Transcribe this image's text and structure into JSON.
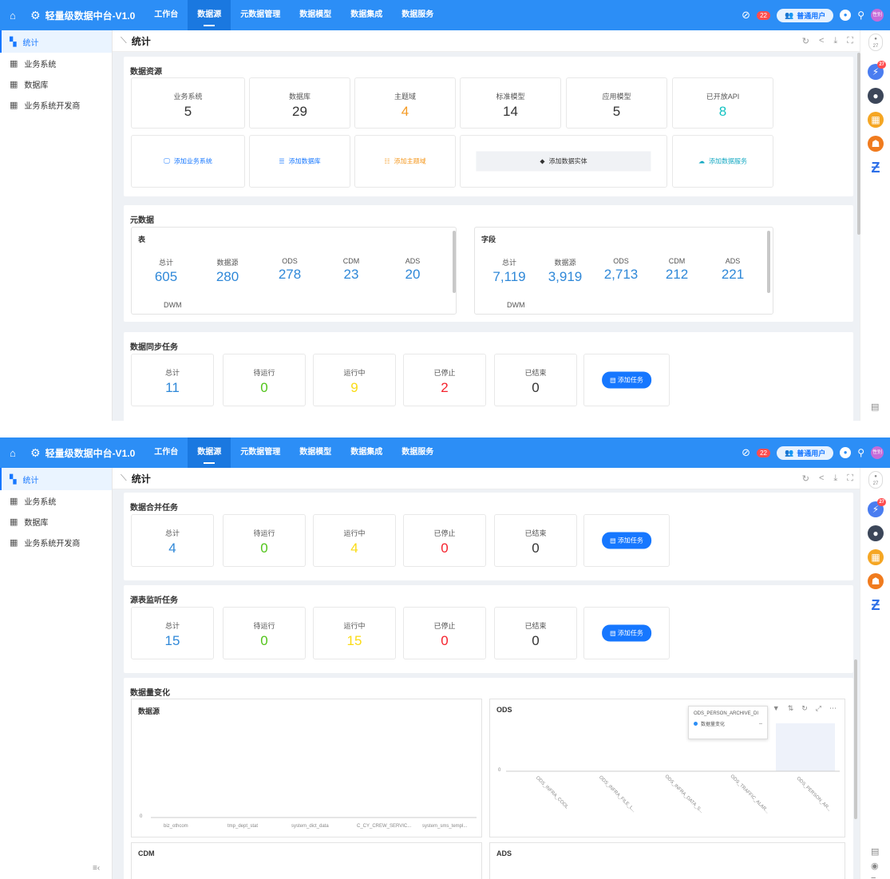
{
  "topbar": {
    "brand": "轻量级数据中台-V1.0",
    "tabs": [
      "工作台",
      "数据源",
      "元数据管理",
      "数据模型",
      "数据集成",
      "数据服务"
    ],
    "active_tab": 1,
    "badge_count": "22",
    "user_label": "普通用户",
    "avatar_text": "性别"
  },
  "sidebar": {
    "items": [
      {
        "label": "统计",
        "icon": "dashboard-icon"
      },
      {
        "label": "业务系统",
        "icon": "table-icon"
      },
      {
        "label": "数据库",
        "icon": "table-icon"
      },
      {
        "label": "业务系统开发商",
        "icon": "table-icon"
      }
    ],
    "collapse_icon": "≡‹"
  },
  "breadcrumb": {
    "title": "统计"
  },
  "rightrail": {
    "top_label": "27",
    "badge": "27"
  },
  "resources": {
    "title": "数据资源",
    "stats": [
      {
        "label": "业务系统",
        "value": "5"
      },
      {
        "label": "数据库",
        "value": "29"
      },
      {
        "label": "主题域",
        "value": "4"
      },
      {
        "label": "标准模型",
        "value": "14"
      },
      {
        "label": "应用模型",
        "value": "5"
      },
      {
        "label": "已开放API",
        "value": "8"
      }
    ],
    "actions": [
      "添加业务系统",
      "添加数据库",
      "添加主题域",
      "添加数据实体",
      "添加数据服务"
    ]
  },
  "metadata": {
    "title": "元数据",
    "tables": {
      "title": "表",
      "labels": [
        "总计",
        "数据源",
        "ODS",
        "CDM",
        "ADS"
      ],
      "values": [
        "605",
        "280",
        "278",
        "23",
        "20"
      ],
      "extra": "DWM"
    },
    "fields": {
      "title": "字段",
      "labels": [
        "总计",
        "数据源",
        "ODS",
        "CDM",
        "ADS"
      ],
      "values": [
        "7,119",
        "3,919",
        "2,713",
        "212",
        "221"
      ],
      "extra": "DWM"
    }
  },
  "task_labels": [
    "总计",
    "待运行",
    "运行中",
    "已停止",
    "已结束"
  ],
  "add_task": "添加任务",
  "sync_tasks": {
    "title": "数据同步任务",
    "values": [
      "11",
      "0",
      "9",
      "2",
      "0"
    ]
  },
  "merge_tasks": {
    "title": "数据合并任务",
    "values": [
      "4",
      "0",
      "4",
      "0",
      "0"
    ]
  },
  "monitor_tasks": {
    "title": "源表监听任务",
    "values": [
      "15",
      "0",
      "15",
      "0",
      "0"
    ]
  },
  "volume": {
    "title": "数据量变化",
    "charts": [
      {
        "title": "数据源",
        "y0": "0",
        "x": [
          "biz_othcom",
          "tmp_dept_stat",
          "system_dict_data",
          "C_CY_CREW_SERVIC...",
          "system_sms_templ..."
        ]
      },
      {
        "title": "ODS",
        "y0": "0",
        "x": [
          "ODS_INFRA_COOL",
          "ODS_INFRA_FILE_L...",
          "ODS_INFRA_DATA_S...",
          "ODS_TRAFFIC_ALAR...",
          "ODS_PERSON_AR..."
        ],
        "tooltip_title": "ODS_PERSON_ARCHIVE_DI",
        "tooltip_series": "数据量变化",
        "tooltip_value": "--"
      },
      {
        "title": "CDM"
      },
      {
        "title": "ADS"
      }
    ]
  },
  "colors": {
    "primary": "#2c8ef6",
    "accent": "#1677ff",
    "orange": "#f59a23",
    "teal": "#13c2c2",
    "green": "#52c41a",
    "red": "#f5222d"
  }
}
